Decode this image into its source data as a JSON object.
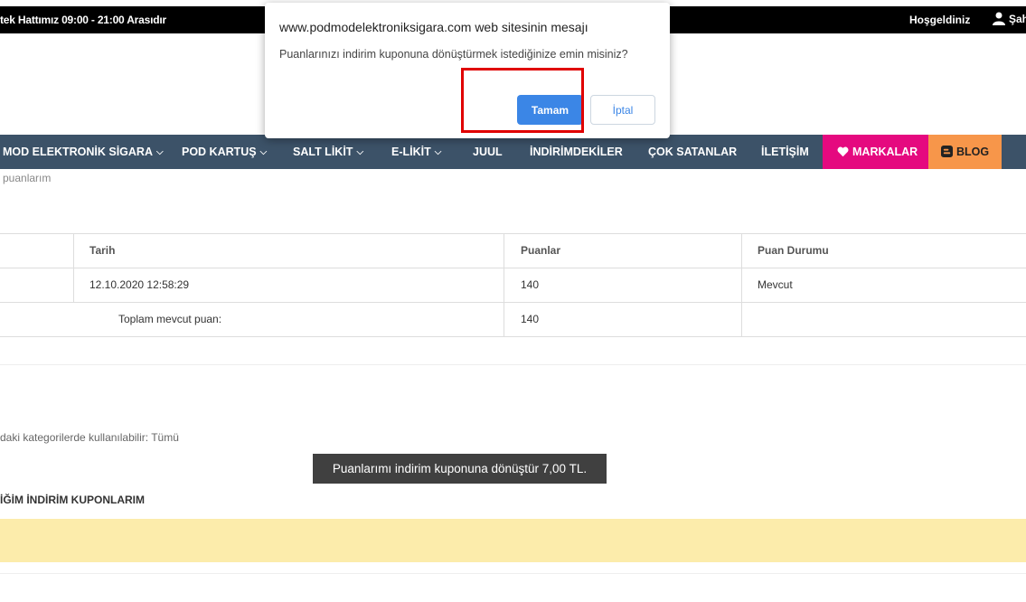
{
  "topbar": {
    "hotline": "tek Hattımız 09:00 - 21:00 Arasıdır",
    "welcome": "Hoşgeldiniz",
    "user_label": "Şah"
  },
  "nav": {
    "items": [
      {
        "label": "MOD ELEKTRONİK SİGARA",
        "has_dropdown": true
      },
      {
        "label": "POD KARTUŞ",
        "has_dropdown": true
      },
      {
        "label": "SALT LİKİT",
        "has_dropdown": true
      },
      {
        "label": "E-LİKİT",
        "has_dropdown": true
      },
      {
        "label": "JUUL",
        "has_dropdown": false
      },
      {
        "label": "İNDİRİMDEKİLER",
        "has_dropdown": false
      },
      {
        "label": "ÇOK SATANLAR",
        "has_dropdown": false
      },
      {
        "label": "İLETİŞİM",
        "has_dropdown": false
      }
    ],
    "markalar": "MARKALAR",
    "blog": "BLOG",
    "colors": {
      "navbar": "#3c5268",
      "markalar": "#e5097f",
      "blog": "#f7964a"
    }
  },
  "breadcrumb": "puanlarım",
  "points_table": {
    "headers": [
      "Tarih",
      "Puanlar",
      "Puan Durumu"
    ],
    "rows": [
      {
        "date": "12.10.2020 12:58:29",
        "points": "140",
        "status": "Mevcut"
      }
    ],
    "total_label": "Toplam mevcut puan:",
    "total_value": "140"
  },
  "categories_text": "daki kategorilerde kullanılabilir: Tümü",
  "convert_button": "Puanlarımı indirim kuponuna dönüştür 7,00 TL.",
  "coupons_title": "İĞİM İNDİRİM KUPONLARIM",
  "dialog": {
    "title": "www.podmodelektroniksigara.com web sitesinin mesajı",
    "message": "Puanlarınızı indirim kuponuna dönüştürmek istediğinize emin misiniz?",
    "ok": "Tamam",
    "cancel": "İptal",
    "accent": "#3b86e6"
  }
}
